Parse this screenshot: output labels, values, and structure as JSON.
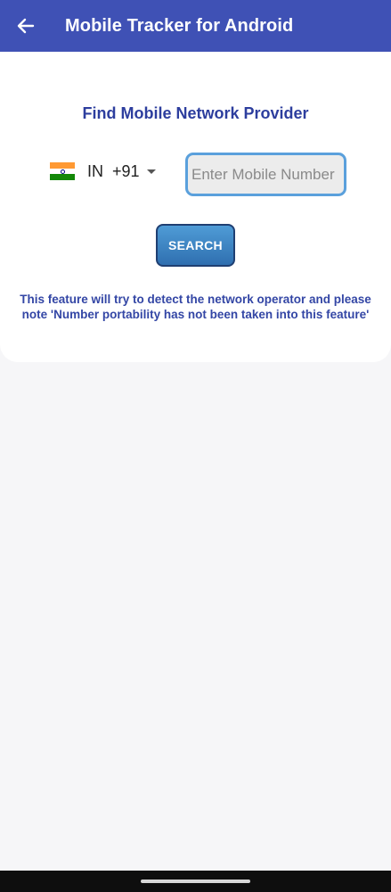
{
  "app_bar": {
    "title": "Mobile Tracker for Android",
    "back_icon": "arrow-left-icon",
    "color": "#3f51b5"
  },
  "card": {
    "title": "Find Mobile Network Provider",
    "country": {
      "flag_icon": "india-flag-icon",
      "code": "IN",
      "dial_code": "+91"
    },
    "phone_input": {
      "value": "",
      "placeholder": "Enter Mobile Number"
    },
    "search_label": "SEARCH",
    "info": "This feature will try to detect the network operator and please note 'Number portability has not been taken into this feature'"
  },
  "colors": {
    "title_text": "#2d3e9e",
    "input_border": "#5aa0dc",
    "button_top": "#4f9cd6",
    "button_bottom": "#2f6fb0"
  }
}
